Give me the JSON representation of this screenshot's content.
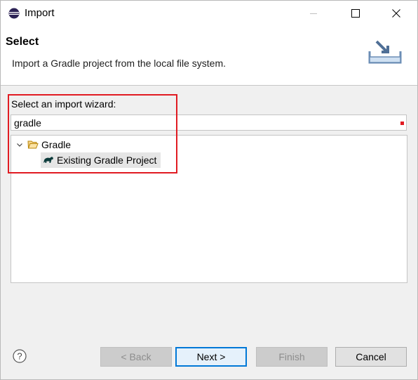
{
  "window": {
    "title": "Import",
    "controls": [
      "minimize",
      "maximize",
      "close"
    ]
  },
  "banner": {
    "title": "Select",
    "description": "Import a Gradle project from the local file system.",
    "icon": "import-wizard-icon"
  },
  "wizard": {
    "label": "Select an import wizard:",
    "filter_value": "gradle",
    "tree": [
      {
        "label": "Gradle",
        "icon": "folder-icon",
        "expanded": true,
        "children": [
          {
            "label": "Existing Gradle Project",
            "icon": "gradle-elephant-icon",
            "selected": true
          }
        ]
      }
    ]
  },
  "footer": {
    "help_icon": "help-icon",
    "buttons": {
      "back": "< Back",
      "next": "Next >",
      "finish": "Finish",
      "cancel": "Cancel"
    }
  },
  "colors": {
    "highlight_box": "#e11b22",
    "default_button_border": "#0078d7",
    "selection_bg": "#e5e5e5"
  }
}
